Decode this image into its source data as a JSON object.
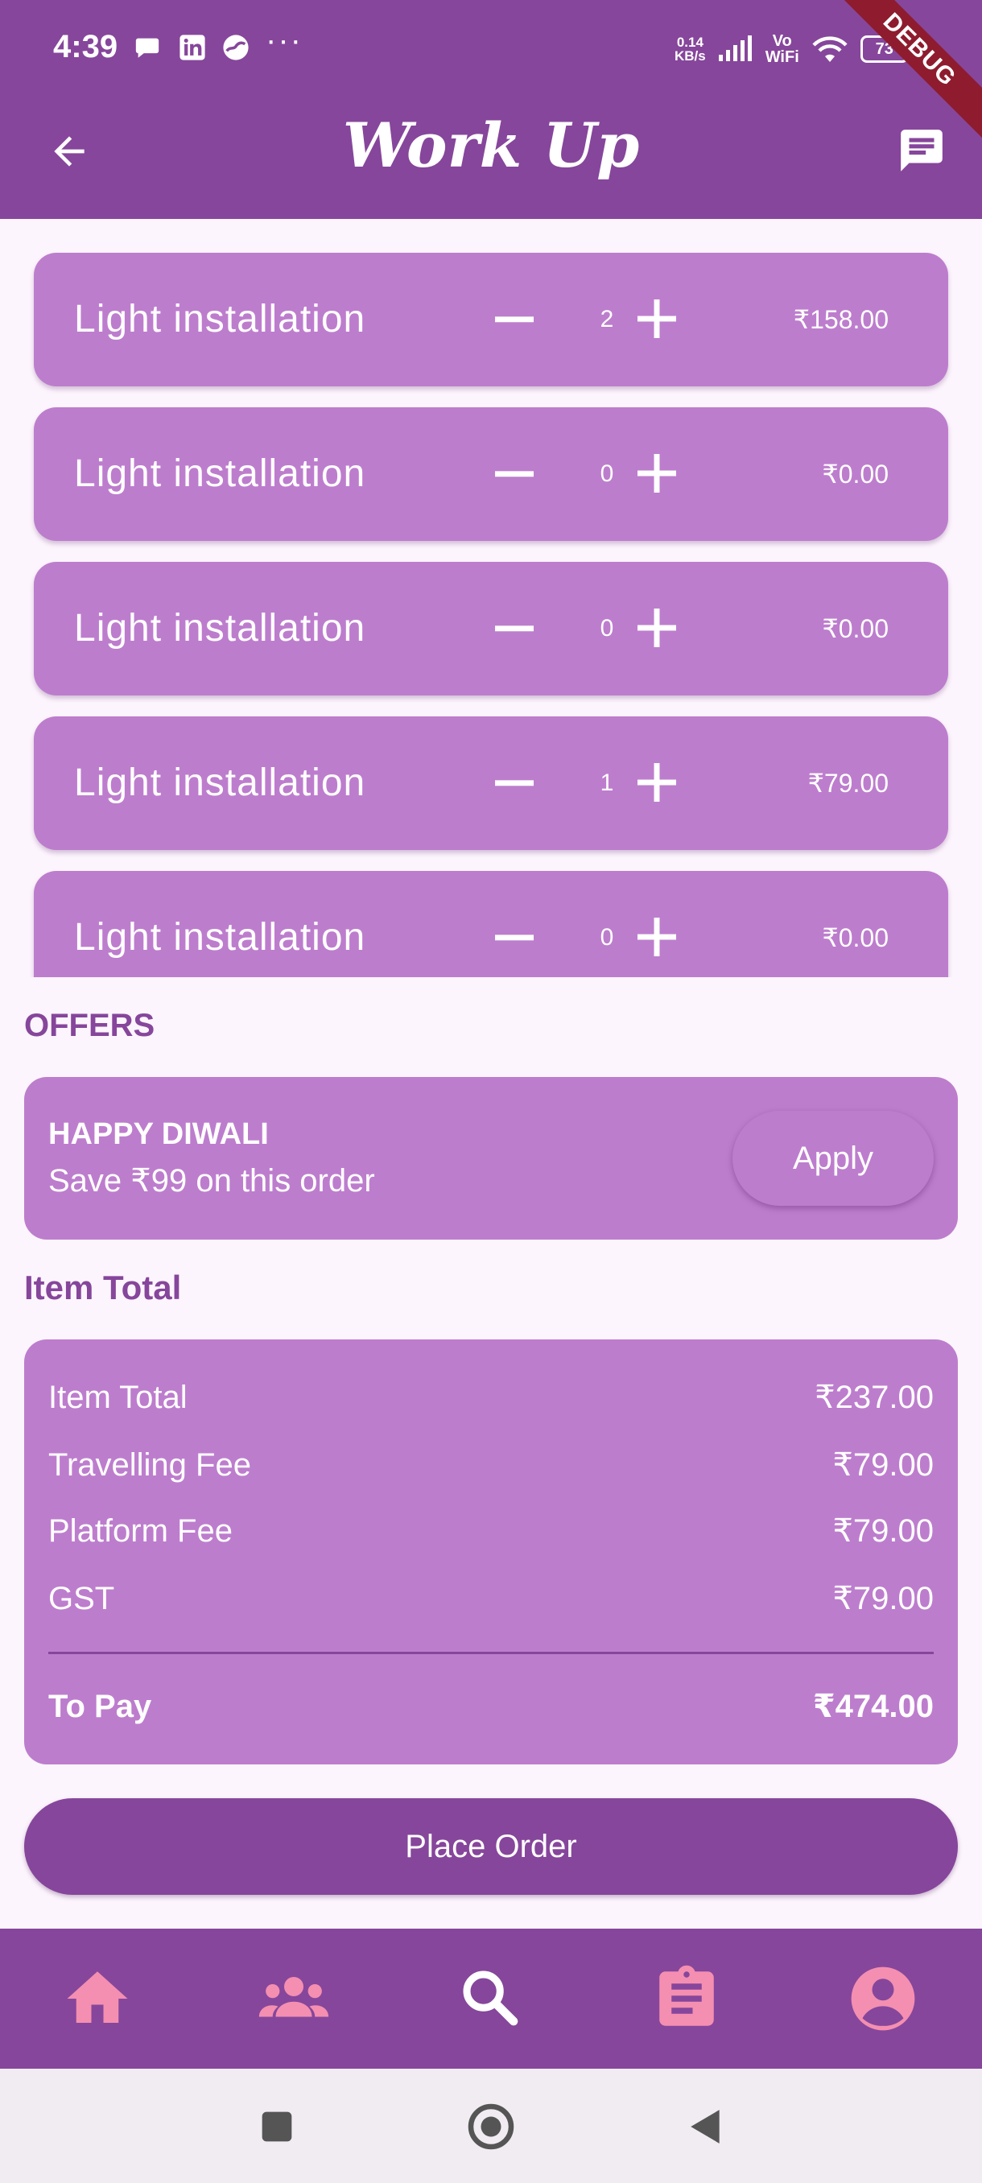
{
  "status_bar": {
    "time": "4:39",
    "network_speed_value": "0.14",
    "network_speed_unit": "KB/s",
    "vowifi_line1": "Vo",
    "vowifi_line2": "WiFi",
    "battery": "73",
    "icons": [
      "chat-bubble-icon",
      "linkedin-icon",
      "app-icon",
      "more-dots-icon",
      "signal-icon",
      "wifi-icon",
      "battery-icon"
    ]
  },
  "debug_banner": "DEBUG",
  "app_bar": {
    "title": "Work Up",
    "back_icon": "arrow-back-icon",
    "chat_icon": "chat-icon"
  },
  "services": [
    {
      "name": "Light installation",
      "qty": "2",
      "price": "₹158.00"
    },
    {
      "name": "Light installation",
      "qty": "0",
      "price": "₹0.00"
    },
    {
      "name": "Light installation",
      "qty": "0",
      "price": "₹0.00"
    },
    {
      "name": "Light installation",
      "qty": "1",
      "price": "₹79.00"
    },
    {
      "name": "Light installation",
      "qty": "0",
      "price": "₹0.00"
    }
  ],
  "offers": {
    "heading": "OFFERS",
    "title": "HAPPY DIWALI",
    "description": "Save ₹99 on this order",
    "apply_label": "Apply"
  },
  "item_total": {
    "heading": "Item Total",
    "rows": [
      {
        "label": "Item Total",
        "value": "₹237.00"
      },
      {
        "label": "Travelling Fee",
        "value": "₹79.00"
      },
      {
        "label": "Platform Fee",
        "value": "₹79.00"
      },
      {
        "label": "GST",
        "value": "₹79.00"
      }
    ],
    "to_pay_label": "To Pay",
    "to_pay_value": "₹474.00"
  },
  "place_order_label": "Place Order",
  "bottom_nav": {
    "items": [
      "home-icon",
      "people-icon",
      "search-icon",
      "assignment-icon",
      "account-icon"
    ],
    "active_color": "#F48FB1",
    "search_color": "#FFFFFF"
  },
  "system_nav": [
    "recent-apps-icon",
    "home-circle-icon",
    "back-triangle-icon"
  ],
  "colors": {
    "primary": "#86469B",
    "card": "#BD7DCD",
    "background": "#FDF5FD"
  }
}
